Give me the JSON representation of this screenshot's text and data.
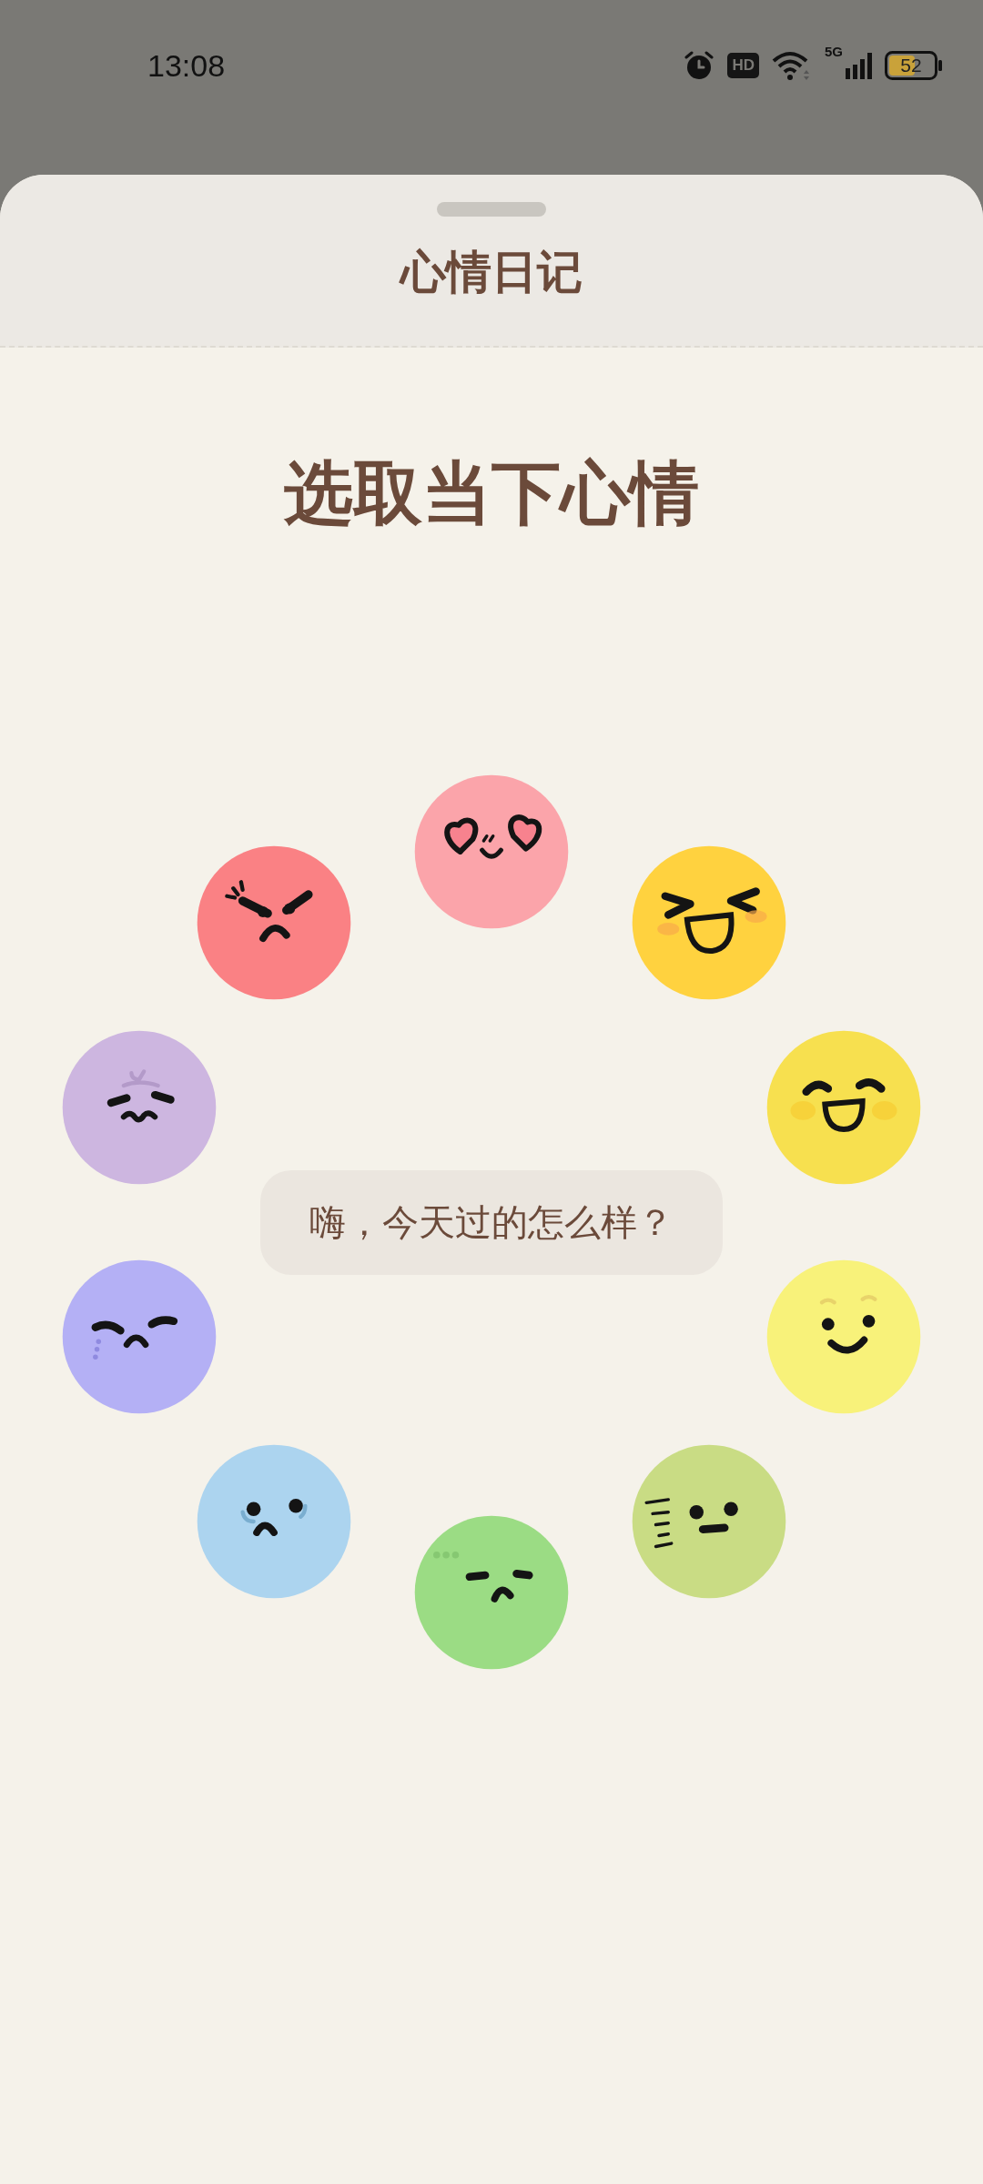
{
  "status_bar": {
    "time": "13:08",
    "hd": "HD",
    "network": "5G",
    "battery": "52"
  },
  "sheet": {
    "title": "心情日记"
  },
  "heading": "选取当下心情",
  "greeting": "嗨，今天过的怎么样？",
  "moods": [
    {
      "kind": "love",
      "color": "#fba4aa"
    },
    {
      "kind": "laugh",
      "color": "#ffd23f"
    },
    {
      "kind": "happy",
      "color": "#f7e04f"
    },
    {
      "kind": "smile",
      "color": "#f8f27a"
    },
    {
      "kind": "meh",
      "color": "#c9dc84"
    },
    {
      "kind": "sad",
      "color": "#9bdc84"
    },
    {
      "kind": "worried",
      "color": "#acd4ef"
    },
    {
      "kind": "crying",
      "color": "#b4b0f5"
    },
    {
      "kind": "anxious",
      "color": "#cdb6e0"
    },
    {
      "kind": "angry",
      "color": "#fa8184"
    }
  ]
}
